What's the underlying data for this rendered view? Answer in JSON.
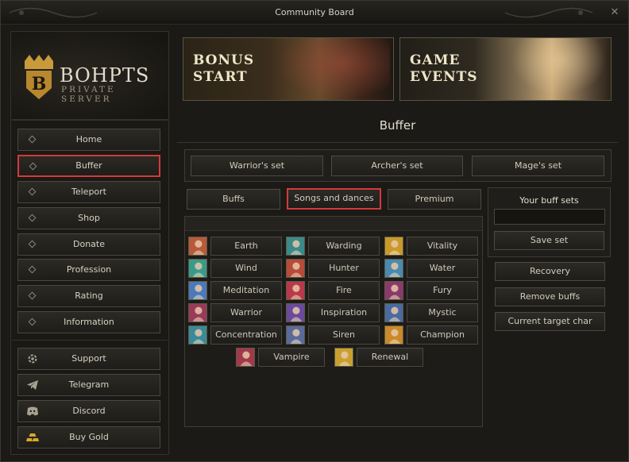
{
  "window": {
    "title": "Community Board"
  },
  "logo": {
    "brand": "BOHPTS",
    "subtitle": "PRIVATE SERVER"
  },
  "nav": {
    "main": [
      {
        "label": "Home"
      },
      {
        "label": "Buffer",
        "active": true
      },
      {
        "label": "Teleport"
      },
      {
        "label": "Shop"
      },
      {
        "label": "Donate"
      },
      {
        "label": "Profession"
      },
      {
        "label": "Rating"
      },
      {
        "label": "Information"
      }
    ],
    "extra": [
      {
        "label": "Support",
        "icon": "support-gear-icon"
      },
      {
        "label": "Telegram",
        "icon": "telegram-icon"
      },
      {
        "label": "Discord",
        "icon": "discord-icon"
      },
      {
        "label": "Buy Gold",
        "icon": "gold-bars-icon"
      }
    ]
  },
  "banners": {
    "left": [
      "BONUS",
      "START"
    ],
    "right": [
      "GAME",
      "EVENTS"
    ]
  },
  "page": {
    "title": "Buffer"
  },
  "sets": {
    "warrior": "Warrior's set",
    "archer": "Archer's set",
    "mage": "Mage's set"
  },
  "tabs": {
    "buffs": "Buffs",
    "songs": "Songs and dances",
    "premium": "Premium",
    "active": "songs"
  },
  "buffs": [
    {
      "label": "Earth",
      "color": "#b85a3a"
    },
    {
      "label": "Warding",
      "color": "#3a8a8a"
    },
    {
      "label": "Vitality",
      "color": "#c99a2a"
    },
    {
      "label": "Wind",
      "color": "#3a9a8a"
    },
    {
      "label": "Hunter",
      "color": "#b84a3a"
    },
    {
      "label": "Water",
      "color": "#4a8ab0"
    },
    {
      "label": "Meditation",
      "color": "#4a7ab8"
    },
    {
      "label": "Fire",
      "color": "#b83a4a"
    },
    {
      "label": "Fury",
      "color": "#8a3a6a"
    },
    {
      "label": "Warrior",
      "color": "#9a3a5a"
    },
    {
      "label": "Inspiration",
      "color": "#6a4a9a"
    },
    {
      "label": "Mystic",
      "color": "#4a6aa0"
    },
    {
      "label": "Concentration",
      "color": "#3a8a9a"
    },
    {
      "label": "Siren",
      "color": "#5a6a9a"
    },
    {
      "label": "Champion",
      "color": "#c98a2a"
    },
    {
      "label": "Vampire",
      "color": "#a03a4a"
    },
    {
      "label": "Renewal",
      "color": "#c9a030"
    }
  ],
  "buffsets": {
    "header": "Your buff sets",
    "input_value": "",
    "save": "Save set"
  },
  "actions": {
    "recovery": "Recovery",
    "remove": "Remove buffs",
    "target": "Current target char"
  }
}
